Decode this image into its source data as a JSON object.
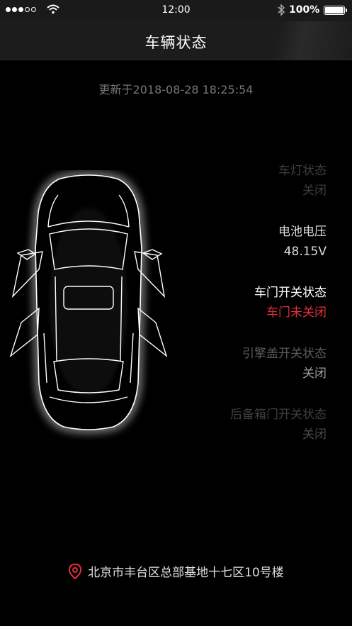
{
  "status_bar": {
    "time": "12:00",
    "battery": "100%",
    "signal_icon": "signal-dots-icon",
    "wifi_icon": "wifi-icon",
    "bluetooth_icon": "bluetooth-icon"
  },
  "nav": {
    "title": "车辆状态"
  },
  "updated_text": "更新于2018-08-28 18:25:54",
  "status_items": [
    {
      "label": "车灯状态",
      "value": "关闭"
    },
    {
      "label": "电池电压",
      "value": "48.15V"
    },
    {
      "label": "车门开关状态",
      "value": "车门未关闭"
    },
    {
      "label": "引擎盖开关状态",
      "value": "关闭"
    },
    {
      "label": "后备箱门开关状态",
      "value": "关闭"
    }
  ],
  "location": {
    "address": "北京市丰台区总部基地十七区10号楼",
    "icon": "location-pin-icon"
  },
  "colors": {
    "background": "#000000",
    "alert": "#e2303c",
    "bar": "#1c1c1c"
  }
}
